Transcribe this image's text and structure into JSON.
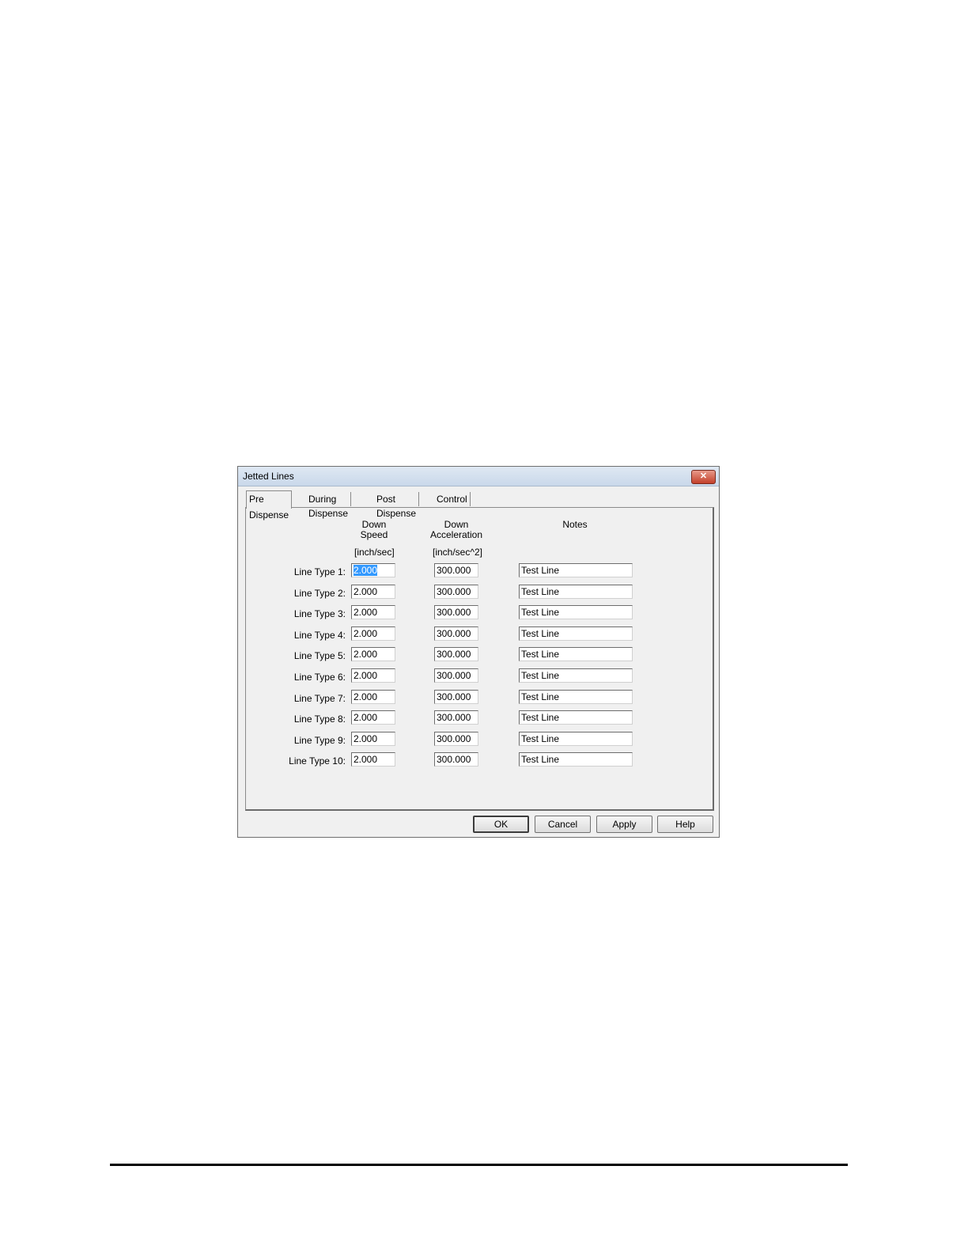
{
  "window": {
    "title": "Jetted Lines",
    "close_symbol": "✕"
  },
  "tabs": [
    {
      "label": "Pre Dispense",
      "active": true
    },
    {
      "label": "During Dispense",
      "active": false
    },
    {
      "label": "Post Dispense",
      "active": false
    },
    {
      "label": "Control",
      "active": false
    }
  ],
  "columns": {
    "speed": {
      "header": "Down\nSpeed",
      "unit": "[inch/sec]"
    },
    "accel": {
      "header": "Down\nAcceleration",
      "unit": "[inch/sec^2]"
    },
    "notes": {
      "header": "Notes"
    }
  },
  "rows": [
    {
      "label": "Line Type 1:",
      "speed": "2.000",
      "accel": "300.000",
      "notes": "Test Line"
    },
    {
      "label": "Line Type 2:",
      "speed": "2.000",
      "accel": "300.000",
      "notes": "Test Line"
    },
    {
      "label": "Line Type 3:",
      "speed": "2.000",
      "accel": "300.000",
      "notes": "Test Line"
    },
    {
      "label": "Line Type 4:",
      "speed": "2.000",
      "accel": "300.000",
      "notes": "Test Line"
    },
    {
      "label": "Line Type 5:",
      "speed": "2.000",
      "accel": "300.000",
      "notes": "Test Line"
    },
    {
      "label": "Line Type 6:",
      "speed": "2.000",
      "accel": "300.000",
      "notes": "Test Line"
    },
    {
      "label": "Line Type 7:",
      "speed": "2.000",
      "accel": "300.000",
      "notes": "Test Line"
    },
    {
      "label": "Line Type 8:",
      "speed": "2.000",
      "accel": "300.000",
      "notes": "Test Line"
    },
    {
      "label": "Line Type 9:",
      "speed": "2.000",
      "accel": "300.000",
      "notes": "Test Line"
    },
    {
      "label": "Line Type 10:",
      "speed": "2.000",
      "accel": "300.000",
      "notes": "Test Line"
    }
  ],
  "buttons": {
    "ok": "OK",
    "cancel": "Cancel",
    "apply": "Apply",
    "help": "Help"
  }
}
